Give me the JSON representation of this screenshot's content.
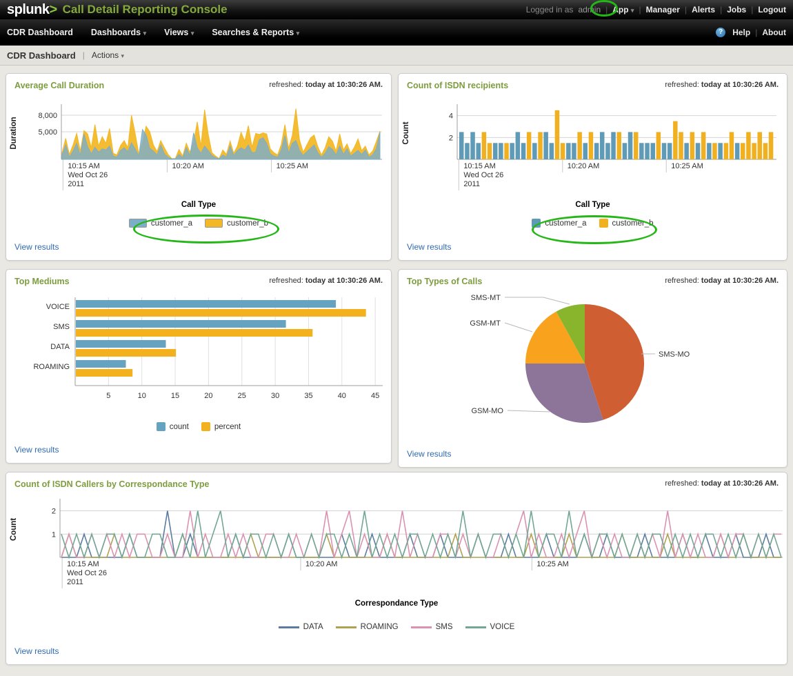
{
  "header": {
    "logo": "splunk",
    "logo_gt": ">",
    "app_title": "Call Detail Reporting Console",
    "logged_in_prefix": "Logged in as",
    "user": "admin",
    "links": {
      "app": "App",
      "manager": "Manager",
      "alerts": "Alerts",
      "jobs": "Jobs",
      "logout": "Logout"
    }
  },
  "nav": {
    "items": [
      {
        "label": "CDR Dashboard",
        "caret": false
      },
      {
        "label": "Dashboards",
        "caret": true
      },
      {
        "label": "Views",
        "caret": true
      },
      {
        "label": "Searches & Reports",
        "caret": true
      }
    ],
    "help": "Help",
    "about": "About"
  },
  "breadcrumb": {
    "title": "CDR Dashboard",
    "actions": "Actions"
  },
  "panels": [
    {
      "title": "Average Call Duration",
      "refreshed_prefix": "refreshed:",
      "refreshed_time": "today at 10:30:26 AM.",
      "view_results": "View results"
    },
    {
      "title": "Count of ISDN recipients",
      "refreshed_prefix": "refreshed:",
      "refreshed_time": "today at 10:30:26 AM.",
      "view_results": "View results"
    },
    {
      "title": "Top Mediums",
      "refreshed_prefix": "refreshed:",
      "refreshed_time": "today at 10:30:26 AM.",
      "view_results": "View results"
    },
    {
      "title": "Top Types of Calls",
      "refreshed_prefix": "refreshed:",
      "refreshed_time": "today at 10:30:26 AM.",
      "view_results": "View results"
    },
    {
      "title": "Count of ISDN Callers by Correspondance Type",
      "refreshed_prefix": "refreshed:",
      "refreshed_time": "today at 10:30:26 AM.",
      "view_results": "View results"
    }
  ],
  "chart_data": [
    {
      "id": "avg_call_duration",
      "type": "area",
      "title": "Average Call Duration",
      "ylabel": "Duration",
      "yticks": [
        {
          "v": 5000,
          "label": "5,000"
        },
        {
          "v": 8000,
          "label": "8,000"
        }
      ],
      "ymax": 9500,
      "x_tick_fracs": [
        0.005,
        0.33,
        0.655
      ],
      "x_tick_labels": [
        [
          "10:15 AM",
          "Wed Oct 26",
          "2011"
        ],
        [
          "10:20 AM"
        ],
        [
          "10:25 AM"
        ]
      ],
      "legend_title": "Call Type",
      "legend_items": [
        {
          "label": "customer_a",
          "color": "#7daec9"
        },
        {
          "label": "customer_b",
          "color": "#f2b827"
        }
      ],
      "series": [
        {
          "name": "customer_a",
          "color": "#7daec9",
          "values": [
            800,
            2600,
            400,
            1500,
            2900,
            700,
            4600,
            2300,
            1000,
            2200,
            1300,
            1900,
            1700,
            2400,
            600,
            400,
            1600,
            2100,
            1400,
            3000,
            1900,
            600,
            5400,
            4400,
            2000,
            1500,
            800,
            2600,
            1000,
            400,
            100,
            100,
            900,
            300,
            2100,
            700,
            4800,
            2100,
            1100,
            2400,
            1600,
            700,
            300,
            100,
            800,
            400,
            2400,
            700,
            1600,
            2100,
            1700,
            2600,
            1200,
            1300,
            3600,
            3900,
            2900,
            1000,
            600,
            400,
            1700,
            4300,
            1100,
            2900,
            3400,
            1600,
            700,
            1400,
            2000,
            2600,
            1200,
            400,
            1100,
            2300,
            1800,
            800,
            2400,
            900,
            1900,
            600,
            1100,
            1600,
            900,
            1700,
            400,
            800,
            1900,
            4900
          ]
        },
        {
          "name": "customer_b",
          "color": "#f2b827",
          "values": [
            1200,
            3800,
            900,
            2600,
            4700,
            1500,
            5200,
            4600,
            2100,
            6300,
            2400,
            4100,
            2900,
            5600,
            1100,
            800,
            2500,
            3400,
            2100,
            8000,
            4700,
            1000,
            3000,
            6000,
            5000,
            2600,
            1400,
            3400,
            2100,
            900,
            150,
            150,
            1800,
            600,
            2900,
            1300,
            3100,
            6800,
            2400,
            9000,
            4500,
            1200,
            600,
            150,
            1700,
            900,
            3300,
            1100,
            2400,
            4900,
            3300,
            6100,
            2200,
            4700,
            4500,
            4800,
            4600,
            1900,
            1200,
            800,
            2700,
            6300,
            2000,
            4300,
            9200,
            3500,
            1300,
            2600,
            3900,
            4400,
            2300,
            800,
            2100,
            4100,
            3300,
            1500,
            4600,
            1700,
            2800,
            1100,
            2200,
            3700,
            1600,
            2400,
            800,
            1500,
            3200,
            5100
          ]
        }
      ]
    },
    {
      "id": "isdn_recipients",
      "type": "bar",
      "title": "Count of ISDN recipients",
      "ylabel": "Count",
      "yticks": [
        {
          "v": 2,
          "label": "2"
        },
        {
          "v": 4,
          "label": "4"
        }
      ],
      "ymax": 4.8,
      "x_tick_fracs": [
        0.005,
        0.33,
        0.655
      ],
      "x_tick_labels": [
        [
          "10:15 AM",
          "Wed Oct 26",
          "2011"
        ],
        [
          "10:20 AM"
        ],
        [
          "10:25 AM"
        ]
      ],
      "legend_title": "Call Type",
      "legend_items": [
        {
          "label": "customer_a",
          "color": "#5f9ab6"
        },
        {
          "label": "customer_b",
          "color": "#f0b020"
        }
      ],
      "colors": {
        "a": "#5f9ab6",
        "b": "#f0b020"
      },
      "bars": [
        {
          "s": "a",
          "v": 2.5
        },
        {
          "s": "a",
          "v": 1.5
        },
        {
          "s": "a",
          "v": 2.5
        },
        {
          "s": "a",
          "v": 1.5
        },
        {
          "s": "b",
          "v": 2.5
        },
        {
          "s": "b",
          "v": 1.5
        },
        {
          "s": "a",
          "v": 1.5
        },
        {
          "s": "a",
          "v": 1.5
        },
        {
          "s": "b",
          "v": 1.5
        },
        {
          "s": "a",
          "v": 1.5
        },
        {
          "s": "a",
          "v": 2.5
        },
        {
          "s": "a",
          "v": 1.5
        },
        {
          "s": "b",
          "v": 2.5
        },
        {
          "s": "a",
          "v": 1.5
        },
        {
          "s": "b",
          "v": 2.5
        },
        {
          "s": "a",
          "v": 2.5
        },
        {
          "s": "a",
          "v": 1.5
        },
        {
          "s": "b",
          "v": 4.5
        },
        {
          "s": "b",
          "v": 1.5
        },
        {
          "s": "a",
          "v": 1.5
        },
        {
          "s": "a",
          "v": 1.5
        },
        {
          "s": "b",
          "v": 2.5
        },
        {
          "s": "a",
          "v": 1.5
        },
        {
          "s": "b",
          "v": 2.5
        },
        {
          "s": "a",
          "v": 1.5
        },
        {
          "s": "a",
          "v": 2.5
        },
        {
          "s": "a",
          "v": 1.5
        },
        {
          "s": "a",
          "v": 2.5
        },
        {
          "s": "b",
          "v": 2.5
        },
        {
          "s": "a",
          "v": 1.5
        },
        {
          "s": "a",
          "v": 2.5
        },
        {
          "s": "b",
          "v": 2.5
        },
        {
          "s": "a",
          "v": 1.5
        },
        {
          "s": "a",
          "v": 1.5
        },
        {
          "s": "a",
          "v": 1.5
        },
        {
          "s": "b",
          "v": 2.5
        },
        {
          "s": "a",
          "v": 1.5
        },
        {
          "s": "a",
          "v": 1.5
        },
        {
          "s": "b",
          "v": 3.5
        },
        {
          "s": "b",
          "v": 2.5
        },
        {
          "s": "a",
          "v": 1.5
        },
        {
          "s": "b",
          "v": 2.5
        },
        {
          "s": "a",
          "v": 1.5
        },
        {
          "s": "b",
          "v": 2.5
        },
        {
          "s": "a",
          "v": 1.5
        },
        {
          "s": "b",
          "v": 1.5
        },
        {
          "s": "a",
          "v": 1.5
        },
        {
          "s": "b",
          "v": 1.5
        },
        {
          "s": "b",
          "v": 2.5
        },
        {
          "s": "a",
          "v": 1.5
        },
        {
          "s": "b",
          "v": 1.5
        },
        {
          "s": "b",
          "v": 2.5
        },
        {
          "s": "b",
          "v": 1.5
        },
        {
          "s": "b",
          "v": 2.5
        },
        {
          "s": "b",
          "v": 1.5
        },
        {
          "s": "b",
          "v": 2.5
        }
      ]
    },
    {
      "id": "top_mediums",
      "type": "hbar",
      "title": "Top Mediums",
      "categories": [
        "VOICE",
        "SMS",
        "DATA",
        "ROAMING"
      ],
      "series": [
        {
          "name": "count",
          "color": "#66a3c0",
          "values": [
            39,
            31.5,
            13.5,
            7.5
          ]
        },
        {
          "name": "percent",
          "color": "#f2b11d",
          "values": [
            43.5,
            35.5,
            15,
            8.5
          ]
        }
      ],
      "xticks": [
        5,
        10,
        15,
        20,
        25,
        30,
        35,
        40,
        45
      ],
      "xmax": 45.5,
      "legend_items": [
        {
          "label": "count",
          "color": "#66a3c0"
        },
        {
          "label": "percent",
          "color": "#f2b11d"
        }
      ]
    },
    {
      "id": "top_types_of_calls",
      "type": "pie",
      "title": "Top Types of Calls",
      "slices": [
        {
          "label": "SMS-MO",
          "percent": 45,
          "color": "#cf5e33"
        },
        {
          "label": "GSM-MO",
          "percent": 30,
          "color": "#8d7599"
        },
        {
          "label": "GSM-MT",
          "percent": 17,
          "color": "#f9a21d"
        },
        {
          "label": "SMS-MT",
          "percent": 8,
          "color": "#89b52d"
        }
      ]
    },
    {
      "id": "isdn_callers_by_type",
      "type": "line",
      "title": "Count of ISDN Callers by Correspondance Type",
      "ylabel": "Count",
      "yticks": [
        {
          "v": 1,
          "label": "1"
        },
        {
          "v": 2,
          "label": "2"
        }
      ],
      "ymax": 2.4,
      "x_tick_fracs": [
        0.003,
        0.333,
        0.653
      ],
      "x_tick_labels": [
        [
          "10:15 AM",
          "Wed Oct 26",
          "2011"
        ],
        [
          "10:20 AM"
        ],
        [
          "10:25 AM"
        ]
      ],
      "legend_title": "Correspondance Type",
      "legend_items": [
        {
          "label": "DATA",
          "color": "#5b7ca0"
        },
        {
          "label": "ROAMING",
          "color": "#b0a14f"
        },
        {
          "label": "SMS",
          "color": "#db92b1"
        },
        {
          "label": "VOICE",
          "color": "#72a794"
        }
      ],
      "series": [
        {
          "name": "DATA",
          "color": "#5b7ca0",
          "values": [
            0,
            0,
            0,
            1,
            0,
            0,
            0,
            0,
            0,
            1,
            0,
            0,
            0,
            0,
            2,
            0,
            0,
            1,
            0,
            0,
            0,
            0,
            0,
            1,
            0,
            0,
            0,
            0,
            0,
            0,
            1,
            0,
            0,
            0,
            0,
            0,
            0,
            1,
            0,
            0,
            0,
            1,
            0,
            0,
            0,
            0,
            1,
            0,
            0,
            0,
            1,
            0,
            0,
            0,
            0,
            1,
            0,
            0,
            0,
            1,
            0,
            0,
            0,
            0,
            1,
            0,
            0,
            0,
            0,
            1,
            0,
            0,
            1,
            0,
            0,
            0,
            0,
            1,
            0,
            0,
            0,
            0,
            1,
            0,
            0,
            1,
            0,
            0,
            0,
            1,
            0,
            0,
            0,
            1,
            0,
            0
          ]
        },
        {
          "name": "ROAMING",
          "color": "#b0a14f",
          "values": [
            0,
            1,
            0,
            0,
            0,
            0,
            0,
            1,
            0,
            0,
            0,
            0,
            0,
            0,
            0,
            0,
            1,
            0,
            0,
            0,
            0,
            0,
            0,
            0,
            0,
            1,
            0,
            0,
            0,
            0,
            0,
            0,
            0,
            0,
            0,
            1,
            0,
            0,
            0,
            0,
            0,
            0,
            0,
            1,
            0,
            0,
            0,
            0,
            0,
            0,
            0,
            0,
            1,
            0,
            0,
            0,
            0,
            0,
            0,
            0,
            0,
            0,
            1,
            0,
            0,
            0,
            0,
            1,
            0,
            0,
            0,
            0,
            0,
            0,
            1,
            0,
            0,
            0,
            0,
            0,
            1,
            0,
            0,
            0,
            0,
            0,
            0,
            1,
            0,
            0,
            1,
            0,
            0,
            0,
            0,
            0
          ]
        },
        {
          "name": "SMS",
          "color": "#db92b1",
          "values": [
            0,
            1,
            0,
            0,
            1,
            0,
            1,
            0,
            1,
            0,
            1,
            1,
            0,
            0,
            1,
            0,
            0,
            2,
            0,
            1,
            0,
            0,
            1,
            0,
            1,
            0,
            0,
            1,
            1,
            0,
            0,
            1,
            0,
            1,
            0,
            2,
            0,
            1,
            2,
            0,
            1,
            0,
            0,
            1,
            0,
            2,
            0,
            1,
            0,
            0,
            1,
            1,
            0,
            1,
            0,
            1,
            0,
            0,
            1,
            0,
            1,
            2,
            0,
            1,
            0,
            0,
            1,
            0,
            1,
            2,
            0,
            1,
            0,
            1,
            0,
            0,
            1,
            0,
            1,
            0,
            2,
            0,
            1,
            0,
            1,
            0,
            0,
            1,
            0,
            1,
            1,
            0,
            1,
            0,
            1,
            1
          ]
        },
        {
          "name": "VOICE",
          "color": "#72a794",
          "values": [
            1,
            0,
            1,
            0,
            1,
            0,
            1,
            1,
            0,
            1,
            0,
            0,
            1,
            1,
            0,
            0,
            1,
            0,
            2,
            0,
            1,
            2,
            0,
            1,
            0,
            1,
            1,
            0,
            1,
            0,
            1,
            0,
            0,
            1,
            0,
            1,
            1,
            0,
            1,
            0,
            2,
            0,
            1,
            0,
            1,
            0,
            1,
            1,
            0,
            1,
            0,
            1,
            0,
            2,
            0,
            1,
            0,
            1,
            1,
            0,
            1,
            0,
            2,
            0,
            1,
            1,
            0,
            2,
            0,
            1,
            0,
            1,
            1,
            0,
            1,
            0,
            1,
            0,
            1,
            1,
            0,
            1,
            0,
            1,
            0,
            1,
            1,
            0,
            1,
            0,
            1,
            0,
            1,
            0,
            1,
            0
          ]
        }
      ]
    }
  ],
  "annotations": {
    "color": "#25b618"
  }
}
